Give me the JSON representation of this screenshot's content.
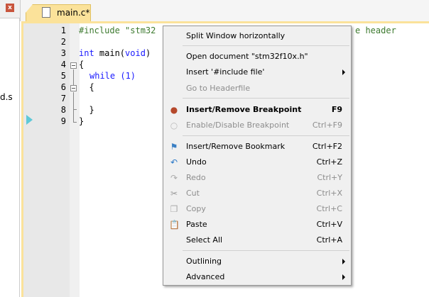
{
  "left_panel": {
    "close_label": "x",
    "file_fragment": "d.s"
  },
  "tab": {
    "label": "main.c*"
  },
  "editor": {
    "line_numbers": [
      "1",
      "2",
      "3",
      "4",
      "5",
      "6",
      "7",
      "8",
      "9"
    ],
    "lines": [
      {
        "pp": "#include ",
        "str": "\"stm32",
        "tail": "e header"
      },
      {},
      {
        "kw": "int",
        "rest": " main(",
        "kw2": "void",
        "end": ")"
      },
      {
        "text": "{"
      },
      {
        "kw": "while",
        "rest": " (1)"
      },
      {
        "text": "  {"
      },
      {},
      {
        "text": "  }"
      },
      {
        "text": "}"
      }
    ]
  },
  "context_menu": {
    "items": [
      {
        "label": "Split Window horizontally"
      },
      {
        "label": "Open document \"stm32f10x.h\""
      },
      {
        "label": "Insert '#include file'",
        "submenu": true
      },
      {
        "label": "Go to Headerfile",
        "disabled": true
      },
      {
        "label": "Insert/Remove Breakpoint",
        "shortcut": "F9",
        "icon": "breakpoint-icon",
        "bold": true
      },
      {
        "label": "Enable/Disable Breakpoint",
        "shortcut": "Ctrl+F9",
        "icon": "breakpoint-disabled-icon",
        "disabled": true
      },
      {
        "label": "Insert/Remove Bookmark",
        "shortcut": "Ctrl+F2",
        "icon": "bookmark-flag-icon"
      },
      {
        "label": "Undo",
        "shortcut": "Ctrl+Z",
        "icon": "undo-icon"
      },
      {
        "label": "Redo",
        "shortcut": "Ctrl+Y",
        "icon": "redo-icon",
        "disabled": true
      },
      {
        "label": "Cut",
        "shortcut": "Ctrl+X",
        "icon": "scissors-icon",
        "disabled": true
      },
      {
        "label": "Copy",
        "shortcut": "Ctrl+C",
        "icon": "copy-icon",
        "disabled": true
      },
      {
        "label": "Paste",
        "shortcut": "Ctrl+V",
        "icon": "paste-icon"
      },
      {
        "label": "Select All",
        "shortcut": "Ctrl+A"
      },
      {
        "label": "Outlining",
        "submenu": true
      },
      {
        "label": "Advanced",
        "submenu": true
      }
    ]
  },
  "colors": {
    "tab_accent": "#fbe29a",
    "keyword": "#1a1aff",
    "preprocessor": "#3d7a2f",
    "breakpoint": "#b5482b"
  }
}
